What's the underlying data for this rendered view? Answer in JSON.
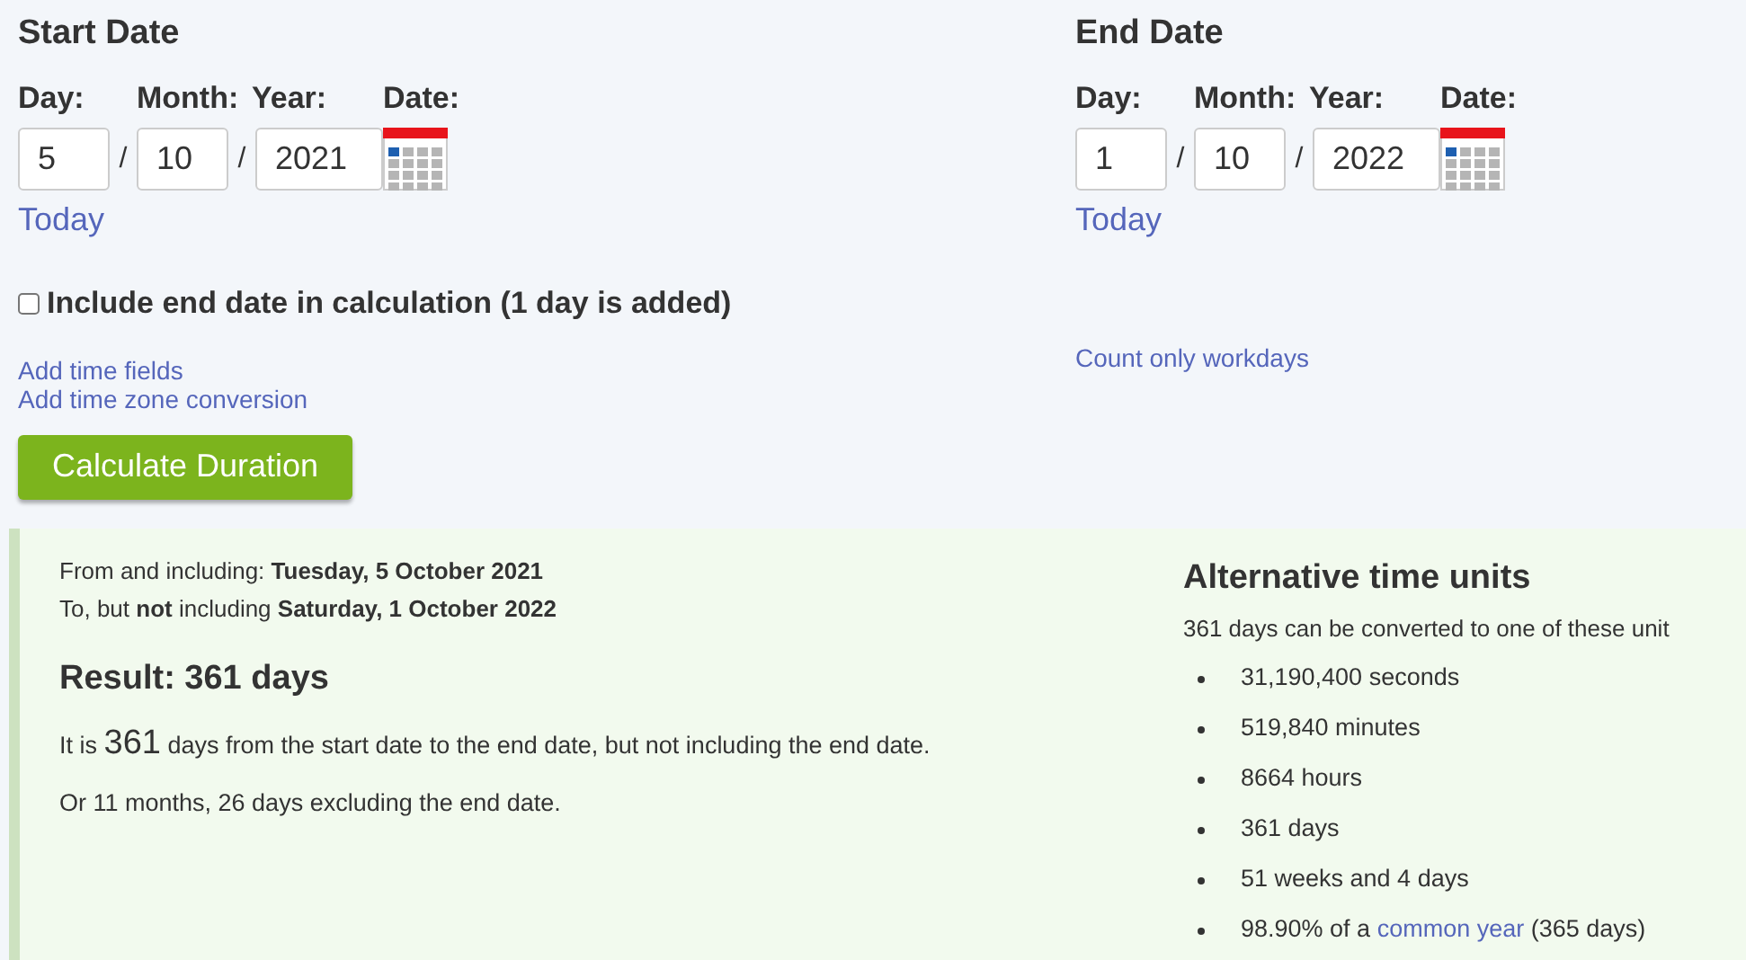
{
  "start": {
    "title": "Start Date",
    "labels": [
      "Day:",
      "Month:",
      "Year:",
      "Date:"
    ],
    "day": "5",
    "month": "10",
    "year": "2021",
    "separator": "/",
    "today_link": "Today"
  },
  "end": {
    "title": "End Date",
    "labels": [
      "Day:",
      "Month:",
      "Year:",
      "Date:"
    ],
    "day": "1",
    "month": "10",
    "year": "2022",
    "separator": "/",
    "today_link": "Today"
  },
  "include_end": {
    "label": "Include end date in calculation (1 day is added)",
    "checked": false
  },
  "links_left": [
    "Add time fields",
    "Add time zone conversion"
  ],
  "links_right": [
    "Count only workdays"
  ],
  "calculate_button": "Calculate Duration",
  "result": {
    "from_line": "From and including: **Tuesday, 5 October 2021**",
    "to_line": "To, but **not** including **Saturday, 1 October 2022**",
    "heading": "Result: 361 days",
    "sentence": {
      "before": "It is",
      "number": "361",
      "after": "days from the start date to the end date, but not including the end date."
    },
    "alt_sentence": "Or 11 months, 26 days excluding the end date."
  },
  "alternative": {
    "heading": "Alternative time units",
    "intro": "361 days can be converted to one of these unit",
    "items": [
      {
        "kind": "text",
        "text": "31,190,400 seconds"
      },
      {
        "kind": "text",
        "text": "519,840 minutes"
      },
      {
        "kind": "text",
        "text": "8664 hours"
      },
      {
        "kind": "text",
        "text": "361 days"
      },
      {
        "kind": "text",
        "text": "51 weeks and 4 days"
      },
      {
        "kind": "link",
        "before": "98.90% of a",
        "link": "common year",
        "after": "(365 days)"
      }
    ]
  }
}
